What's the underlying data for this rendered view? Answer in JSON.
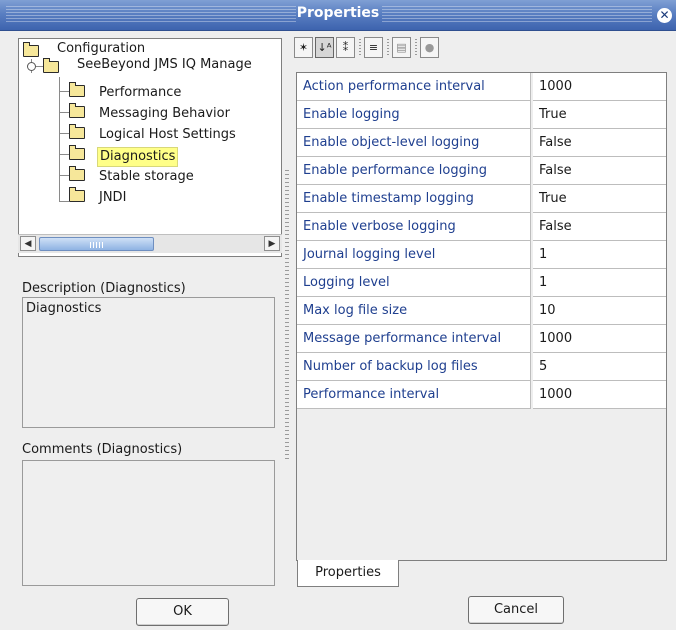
{
  "window": {
    "title": "Properties"
  },
  "tree": {
    "root": "Configuration",
    "parent": "SeeBeyond JMS IQ Manage",
    "children": [
      "Performance",
      "Messaging Behavior",
      "Logical Host Settings",
      "Diagnostics",
      "Stable storage",
      "JNDI"
    ],
    "selected": "Diagnostics"
  },
  "description": {
    "label": "Description (Diagnostics)",
    "text": "Diagnostics"
  },
  "comments": {
    "label": "Comments (Diagnostics)",
    "text": ""
  },
  "toolbar": {
    "buttons": [
      "pin-icon",
      "sort-alpha-icon",
      "sort-category-icon",
      "filter-icon",
      "table-icon",
      "help-icon"
    ]
  },
  "properties": [
    {
      "name": "Action performance interval",
      "value": "1000"
    },
    {
      "name": "Enable logging",
      "value": "True"
    },
    {
      "name": "Enable object-level logging",
      "value": "False"
    },
    {
      "name": "Enable performance logging",
      "value": "False"
    },
    {
      "name": "Enable timestamp logging",
      "value": "True"
    },
    {
      "name": "Enable verbose logging",
      "value": "False"
    },
    {
      "name": "Journal logging level",
      "value": "1"
    },
    {
      "name": "Logging level",
      "value": "1"
    },
    {
      "name": "Max log file size",
      "value": "10"
    },
    {
      "name": "Message performance interval",
      "value": "1000"
    },
    {
      "name": "Number of backup log files",
      "value": "5"
    },
    {
      "name": "Performance interval",
      "value": "1000"
    }
  ],
  "tabs": {
    "properties": "Properties"
  },
  "buttons": {
    "ok": "OK",
    "cancel": "Cancel"
  }
}
